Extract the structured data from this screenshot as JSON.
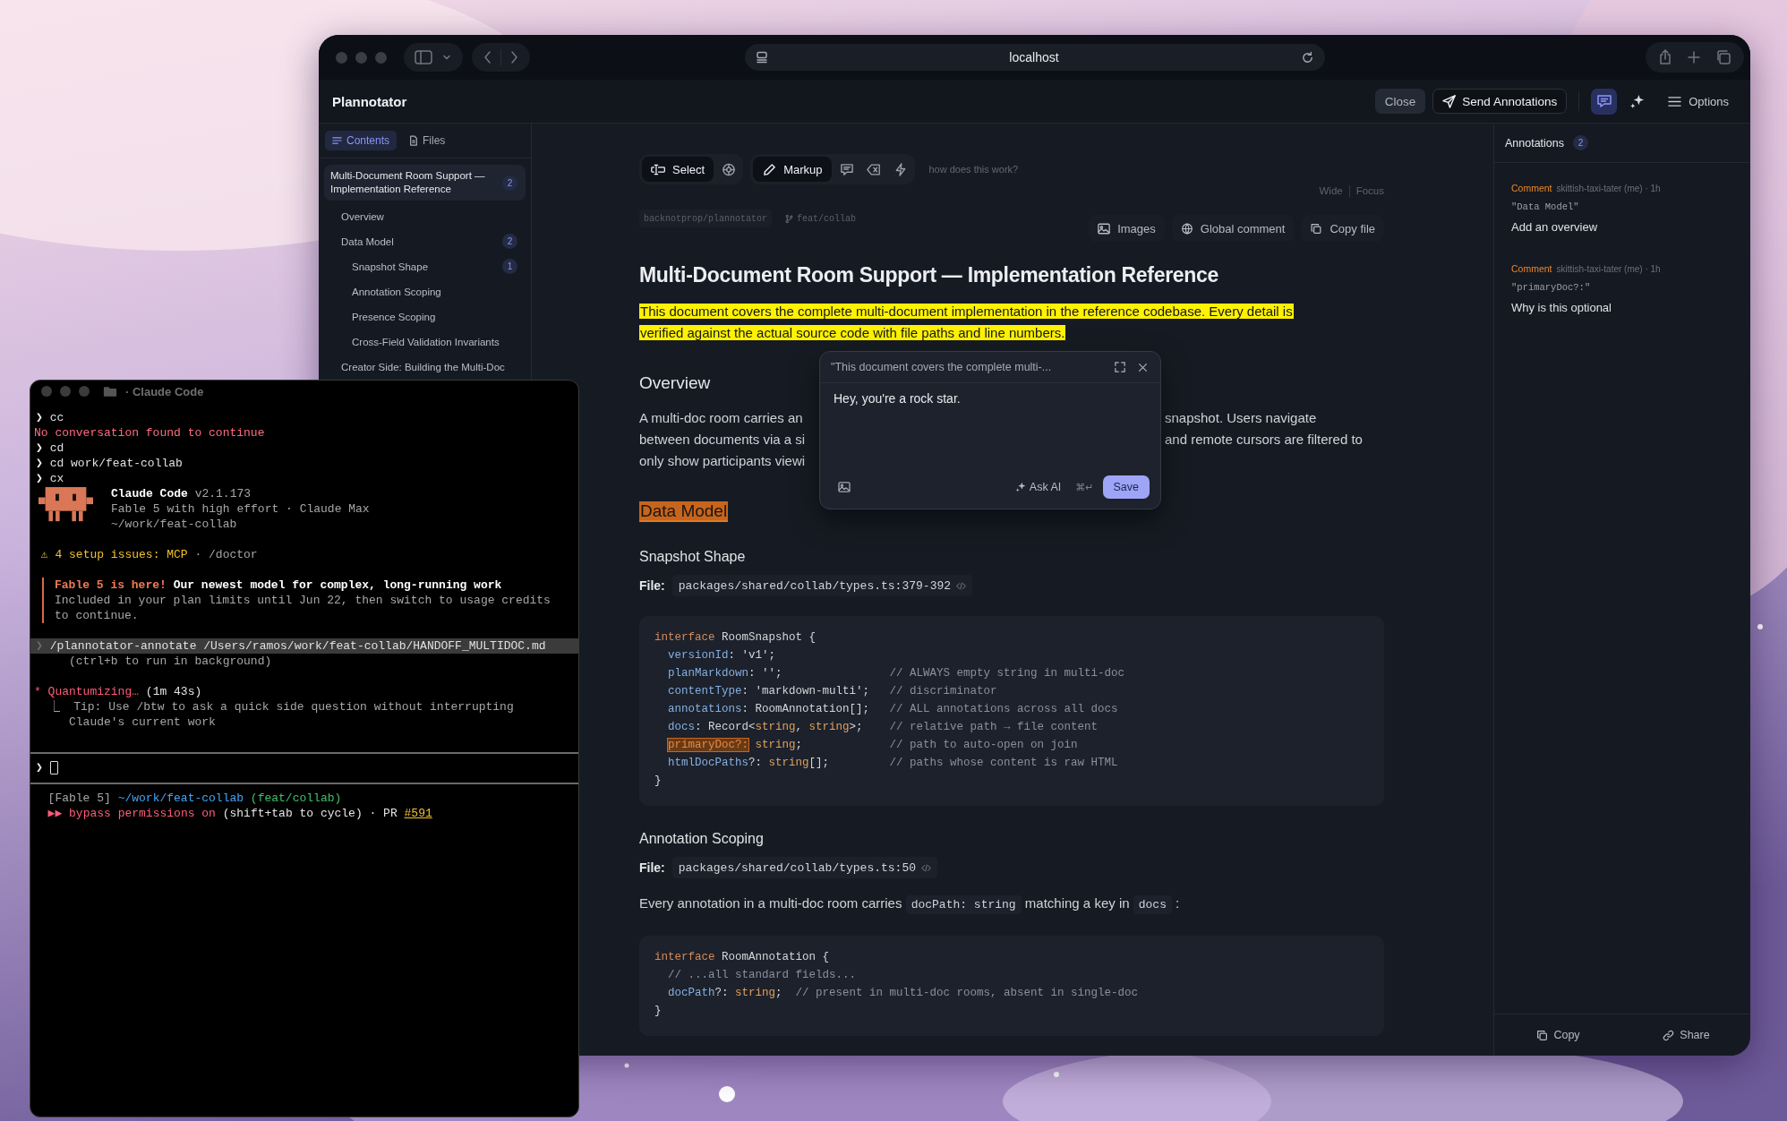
{
  "browser": {
    "url": "localhost"
  },
  "app": {
    "title": "Plannotator",
    "actions": [
      {
        "label": "Close",
        "kind": "plain"
      },
      {
        "label": "Send Annotations",
        "kind": "send"
      }
    ],
    "panel_toggle": {
      "on": true
    },
    "options": "Options"
  },
  "sidebar": {
    "tabs": [
      {
        "label": "Contents",
        "selected": true
      },
      {
        "label": "Files",
        "selected": false
      }
    ],
    "items": [
      {
        "label": "Multi-Document Room Support — Implementation Reference",
        "count": "2",
        "selected": true,
        "children": [
          {
            "label": "Overview",
            "selected": false
          },
          {
            "label": "Data Model",
            "count": "2",
            "selected": false,
            "children": [
              {
                "label": "Snapshot Shape",
                "count": "1",
                "selected": false
              },
              {
                "label": "Annotation Scoping",
                "selected": false
              },
              {
                "label": "Presence Scoping",
                "selected": false
              },
              {
                "label": "Cross-Field Validation Invariants",
                "selected": false
              }
            ]
          },
          {
            "label": "Creator Side: Building the Multi-Doc",
            "selected": false
          }
        ]
      }
    ]
  },
  "toolbar": {
    "groups": [
      {
        "items": [
          {
            "label": "Select",
            "selected": true
          },
          {
            "selected": false
          }
        ]
      },
      {
        "items": [
          {
            "label": "Markup",
            "selected": true
          },
          {
            "selected": false
          },
          {
            "selected": false
          },
          {
            "selected": false
          }
        ]
      }
    ],
    "help": "how does this work?"
  },
  "view_options": [
    "Wide",
    "Focus"
  ],
  "repo_tags": [
    {
      "kind": "repo",
      "text": "backnotprop/plannotator"
    },
    {
      "kind": "branch",
      "text": "feat/collab"
    }
  ],
  "doc_actions": [
    "Images",
    "Global comment",
    "Copy file"
  ],
  "document": [
    {
      "kind": "h1",
      "text": "Multi-Document Room Support — Implementation Reference"
    },
    {
      "kind": "p",
      "highlighted": true,
      "text": "This document covers the complete multi-document implementation in the reference codebase. Every detail is verified against the actual source code with file paths and line numbers."
    },
    {
      "kind": "h2",
      "text": "Overview"
    },
    {
      "kind": "covered_p",
      "lines": [
        {
          "left": "A multi-doc room carries an",
          "right": "snapshot. Users navigate"
        },
        {
          "left": "between documents via a si",
          "right": "and remote cursors are filtered to"
        },
        {
          "left": "only show participants viewi"
        }
      ]
    },
    {
      "kind": "h2",
      "text": "Data Model",
      "annotated": true
    },
    {
      "kind": "h3",
      "text": "Snapshot Shape"
    },
    {
      "kind": "file",
      "label": "File:",
      "path": "packages/shared/collab/types.ts:379-392"
    },
    {
      "kind": "code",
      "lines": [
        {
          "segments": [
            {
              "kind": "keyword",
              "text": "interface"
            },
            {
              "kind": "plain",
              "text": " RoomSnapshot {"
            }
          ]
        },
        {
          "segments": [
            {
              "kind": "prop",
              "text": "  versionId"
            },
            {
              "kind": "plain",
              "text": ": 'v1';"
            }
          ]
        },
        {
          "segments": [
            {
              "kind": "prop",
              "text": "  planMarkdown"
            },
            {
              "kind": "plain",
              "text": ": '';"
            }
          ],
          "comment": "// ALWAYS empty string in multi-doc"
        },
        {
          "segments": [
            {
              "kind": "prop",
              "text": "  contentType"
            },
            {
              "kind": "plain",
              "text": ": 'markdown-multi';"
            }
          ],
          "comment": "// discriminator"
        },
        {
          "segments": [
            {
              "kind": "prop",
              "text": "  annotations"
            },
            {
              "kind": "plain",
              "text": ": RoomAnnotation[];"
            }
          ],
          "comment": "// ALL annotations across all docs"
        },
        {
          "segments": [
            {
              "kind": "prop",
              "text": "  docs"
            },
            {
              "kind": "plain",
              "text": ": Record<"
            },
            {
              "kind": "type",
              "text": "string"
            },
            {
              "kind": "plain",
              "text": ", "
            },
            {
              "kind": "type",
              "text": "string"
            },
            {
              "kind": "plain",
              "text": ">;"
            }
          ],
          "comment": "// relative path → file content"
        },
        {
          "segments": [
            {
              "kind": "mark",
              "text": "primaryDoc?:"
            },
            {
              "kind": "type",
              "text": " string"
            },
            {
              "kind": "plain",
              "text": ";"
            }
          ],
          "comment": "// path to auto-open on join"
        },
        {
          "segments": [
            {
              "kind": "prop",
              "text": "  htmlDocPaths"
            },
            {
              "kind": "plain",
              "text": "?: "
            },
            {
              "kind": "type",
              "text": "string"
            },
            {
              "kind": "plain",
              "text": "[];"
            }
          ],
          "comment": "// paths whose content is raw HTML"
        },
        {
          "segments": [
            {
              "kind": "plain",
              "text": "}"
            }
          ]
        }
      ]
    },
    {
      "kind": "h3",
      "text": "Annotation Scoping"
    },
    {
      "kind": "file",
      "label": "File:",
      "path": "packages/shared/collab/types.ts:50"
    },
    {
      "kind": "p",
      "segments": [
        {
          "text": "Every annotation in a multi-doc room carries "
        },
        {
          "text": "docPath: string",
          "code": true
        },
        {
          "text": " matching a key in "
        },
        {
          "text": "docs",
          "code": true
        },
        {
          "text": " :"
        }
      ]
    },
    {
      "kind": "code",
      "lines": [
        {
          "segments": [
            {
              "kind": "keyword",
              "text": "interface"
            },
            {
              "kind": "plain",
              "text": " RoomAnnotation {"
            }
          ]
        },
        {
          "segments": [
            {
              "kind": "comment",
              "text": "  // ...all standard fields..."
            }
          ]
        },
        {
          "segments": [
            {
              "kind": "prop",
              "text": "  docPath"
            },
            {
              "kind": "plain",
              "text": "?: "
            },
            {
              "kind": "type",
              "text": "string"
            },
            {
              "kind": "plain",
              "text": ";  "
            },
            {
              "kind": "comment",
              "text": "// present in multi-doc rooms, absent in single-doc"
            }
          ]
        },
        {
          "segments": [
            {
              "kind": "plain",
              "text": "}"
            }
          ]
        }
      ]
    }
  ],
  "comment_popup": {
    "quote": "\"This document covers the complete multi-...",
    "value": "Hey, you're a rock star.",
    "ask_ai": "Ask AI",
    "shortcut": "⌘↵",
    "save": "Save"
  },
  "annotations": {
    "title": "Annotations",
    "count": "2",
    "items": [
      {
        "kind": "comment",
        "type": "Comment",
        "author": "skittish-taxi-tater (me) · 1h",
        "quote": "\"Data Model\"",
        "text": "Add an overview"
      },
      {
        "kind": "comment",
        "type": "Comment",
        "author": "skittish-taxi-tater (me) · 1h",
        "quote": "\"primaryDoc?:\"",
        "text": "Why is this optional"
      }
    ],
    "footer": [
      "Copy",
      "Share"
    ]
  },
  "terminal": {
    "title": "· Claude Code",
    "lines": [
      {
        "kind": "prompt",
        "prompt": "❯",
        "text": "cc"
      },
      {
        "kind": "text",
        "segments": [
          {
            "kind": "error",
            "text": "No conversation found to continue"
          }
        ]
      },
      {
        "kind": "prompt",
        "prompt": "❯",
        "text": "cd"
      },
      {
        "kind": "prompt",
        "prompt": "❯",
        "text": "cd work/feat-collab"
      },
      {
        "kind": "prompt",
        "prompt": "❯",
        "text": "cx"
      },
      {
        "kind": "banner",
        "rows": [
          {
            "segments": [
              {
                "kind": "bold",
                "text": "Claude Code"
              },
              {
                "kind": "dim",
                "text": " v2.1.173"
              }
            ]
          },
          {
            "segments": [
              {
                "kind": "dim",
                "text": "Fable 5 with high effort · Claude Max"
              }
            ]
          },
          {
            "segments": [
              {
                "kind": "dim",
                "text": "~/work/feat-collab"
              }
            ]
          }
        ]
      },
      {
        "kind": "blank"
      },
      {
        "kind": "text",
        "segments": [
          {
            "kind": "warn",
            "text": " ⚠ 4 setup issues: MCP"
          },
          {
            "kind": "dim",
            "text": " · /doctor"
          }
        ]
      },
      {
        "kind": "blank"
      },
      {
        "kind": "callout",
        "rows": [
          {
            "segments": [
              {
                "kind": "accent",
                "text": "Fable 5 is here!"
              },
              {
                "kind": "bold",
                "text": " Our newest model for complex, long-running work"
              }
            ]
          },
          {
            "segments": [
              {
                "kind": "dim",
                "text": "Included in your plan limits until Jun 22, then switch to usage credits"
              }
            ]
          },
          {
            "segments": [
              {
                "kind": "dim",
                "text": "to continue."
              }
            ]
          }
        ]
      },
      {
        "kind": "blank"
      },
      {
        "kind": "highlight",
        "prompt": "❯",
        "text": "/plannotator-annotate /Users/ramos/work/feat-collab/HANDOFF_MULTIDOC.md"
      },
      {
        "kind": "text",
        "segments": [
          {
            "kind": "dim",
            "text": "     (ctrl+b to run in background)"
          }
        ]
      },
      {
        "kind": "blank"
      },
      {
        "kind": "text",
        "segments": [
          {
            "kind": "status",
            "text": "* Quantumizing…"
          },
          {
            "kind": "plain",
            "text": " (1m 43s)"
          }
        ]
      },
      {
        "kind": "text",
        "segments": [
          {
            "kind": "dim",
            "text": "  ⎿  Tip: Use /btw to ask a quick side question without interrupting"
          }
        ]
      },
      {
        "kind": "text",
        "segments": [
          {
            "kind": "dim",
            "text": "     Claude's current work"
          }
        ]
      },
      {
        "kind": "blank"
      },
      {
        "kind": "rule"
      },
      {
        "kind": "input",
        "prompt": "❯"
      },
      {
        "kind": "rule"
      },
      {
        "kind": "text",
        "segments": [
          {
            "kind": "dim",
            "text": "  [Fable 5] "
          },
          {
            "kind": "path",
            "text": "~/work/feat-collab"
          },
          {
            "kind": "branch",
            "text": " (feat/collab)"
          }
        ]
      },
      {
        "kind": "text",
        "segments": [
          {
            "kind": "status",
            "text": "  ▶▶ bypass permissions on"
          },
          {
            "kind": "plain",
            "text": " (shift+tab to cycle) · PR "
          },
          {
            "kind": "link",
            "text": "#591"
          }
        ]
      }
    ]
  }
}
